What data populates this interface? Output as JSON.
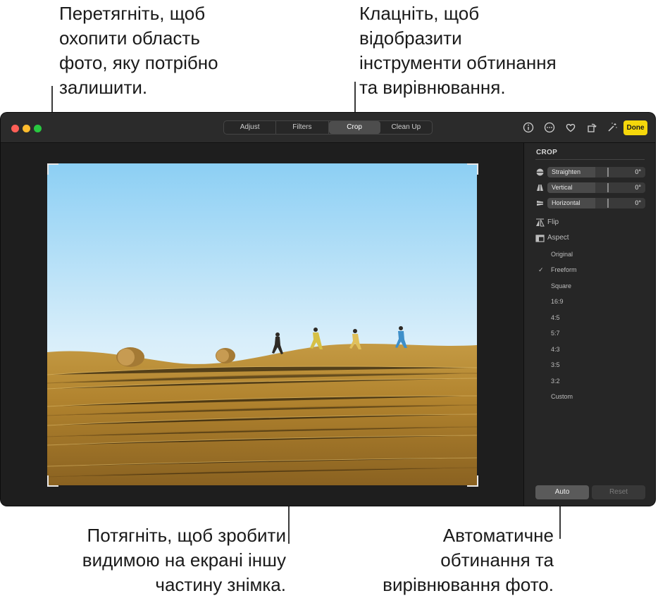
{
  "callouts": {
    "top_left": [
      "Перетягніть, щоб",
      "охопити область",
      "фото, яку потрібно",
      "залишити."
    ],
    "top_right": [
      "Клацніть, щоб",
      "відобразити",
      "інструменти обтинання",
      "та вирівнювання."
    ],
    "bottom_left": [
      "Потягніть, щоб зробити",
      "видимою на екрані іншу",
      "частину знімка."
    ],
    "bottom_right": [
      "Автоматичне",
      "обтинання та",
      "вирівнювання фото."
    ]
  },
  "window": {
    "traffic_lights": {
      "close": "#ff5f57",
      "minimize": "#febc2e",
      "zoom": "#28c840"
    },
    "tabs": [
      {
        "label": "Adjust",
        "active": false
      },
      {
        "label": "Filters",
        "active": false
      },
      {
        "label": "Crop",
        "active": true
      },
      {
        "label": "Clean Up",
        "active": false
      }
    ],
    "toolbar_icons": [
      "info-icon",
      "more-icon",
      "heart-icon",
      "rotate-icon",
      "magic-wand-icon"
    ],
    "done_label": "Done",
    "accent_color": "#f5d70b"
  },
  "sidebar": {
    "title": "CROP",
    "sliders": [
      {
        "label": "Straighten",
        "value": "0°",
        "icon": "straighten-icon"
      },
      {
        "label": "Vertical",
        "value": "0°",
        "icon": "vertical-perspective-icon"
      },
      {
        "label": "Horizontal",
        "value": "0°",
        "icon": "horizontal-perspective-icon"
      }
    ],
    "flip_label": "Flip",
    "aspect_label": "Aspect",
    "aspect_options": [
      "Original",
      "Freeform",
      "Square",
      "16:9",
      "4:5",
      "5:7",
      "4:3",
      "3:5",
      "3:2",
      "Custom"
    ],
    "selected_aspect": "Freeform",
    "check_mark": "✓",
    "auto_label": "Auto",
    "reset_label": "Reset"
  }
}
